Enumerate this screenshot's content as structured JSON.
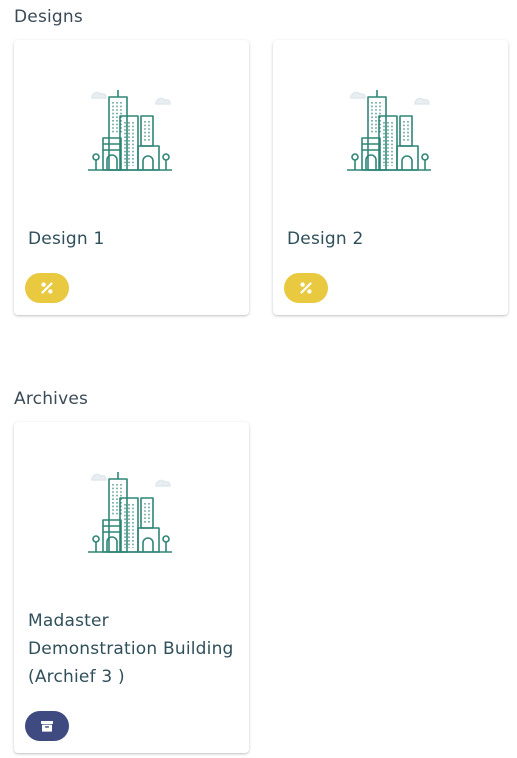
{
  "sections": {
    "designs": {
      "title": "Designs",
      "cards": [
        {
          "title": "Design 1",
          "badge_icon": "percent-icon",
          "badge_color": "#e8c93f"
        },
        {
          "title": "Design 2",
          "badge_icon": "percent-icon",
          "badge_color": "#e8c93f"
        }
      ]
    },
    "archives": {
      "title": "Archives",
      "cards": [
        {
          "title": "Madaster Demonstration Building (Archief 3 )",
          "badge_icon": "archive-box-icon",
          "badge_color": "#3e4a80"
        }
      ]
    }
  },
  "colors": {
    "illustration_stroke": "#2f8577",
    "illustration_cloud": "#dfe8ec"
  }
}
